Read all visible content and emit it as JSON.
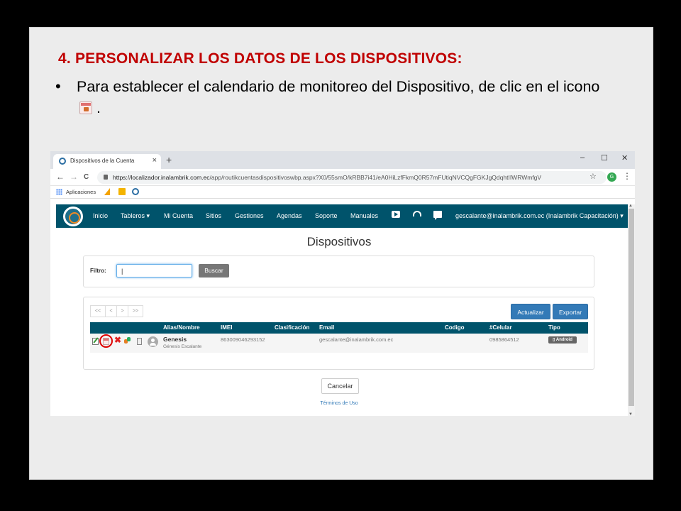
{
  "slide": {
    "title": "4. PERSONALIZAR LOS DATOS DE LOS DISPOSITIVOS:",
    "bullet_part1": "Para establecer el calendario de monitoreo del Dispositivo, de clic en el icono",
    "bullet_part2": ".",
    "bullet_icon": "calendar-icon"
  },
  "browser": {
    "tab_title": "Dispositivos de la Cuenta",
    "tab_close": "×",
    "new_tab": "+",
    "window_controls": [
      "–",
      "☐",
      "✕"
    ],
    "nav": {
      "back": "←",
      "forward": "→",
      "reload": "C"
    },
    "url_host": "https://localizador.inalambrik.com.ec",
    "url_path": "/app/routikcuentasdispositivoswbp.aspx?X0/55smO/kRBB7i41/eA0HiLzfFkmQ0R57mFUtiqNVCQgFGKJgQdqhtIIWRWmfgV",
    "star": "☆",
    "profile_initial": "G",
    "menu": "⋮",
    "bookmarks_label": "Aplicaciones"
  },
  "app": {
    "nav_items": [
      "Inicio",
      "Tableros ▾",
      "Mi Cuenta",
      "Sitios",
      "Gestiones",
      "Agendas",
      "Soporte",
      "Manuales"
    ],
    "nav_icons": [
      "youtube-icon",
      "headset-icon",
      "chat-icon"
    ],
    "user": "gescalante@inalambrik.com.ec (Inalambrik Capacitación) ▾",
    "page_title": "Dispositivos",
    "filter": {
      "label": "Filtro:",
      "value": "|",
      "button": "Buscar"
    },
    "pager": [
      "<<",
      "<",
      ">",
      ">>"
    ],
    "buttons": {
      "update": "Actualizar",
      "export": "Exportar"
    },
    "columns": [
      "Alias/Nombre",
      "IMEI",
      "Clasificación",
      "Email",
      "Codigo",
      "#Celular",
      "Tipo"
    ],
    "rows": [
      {
        "alias": "Genesis",
        "name": "Génesis Escalante",
        "imei": "863009046293152",
        "classification": "",
        "email": "gescalante@inalambrik.com.ec",
        "code": "",
        "phone": "0985864512",
        "type": "Android"
      }
    ],
    "cancel": "Cancelar",
    "terms": "Términos de Uso"
  },
  "colors": {
    "title_red": "#c00000",
    "nav_teal": "#00536b",
    "button_blue": "#337ab7",
    "highlight_red": "#dd0000"
  }
}
